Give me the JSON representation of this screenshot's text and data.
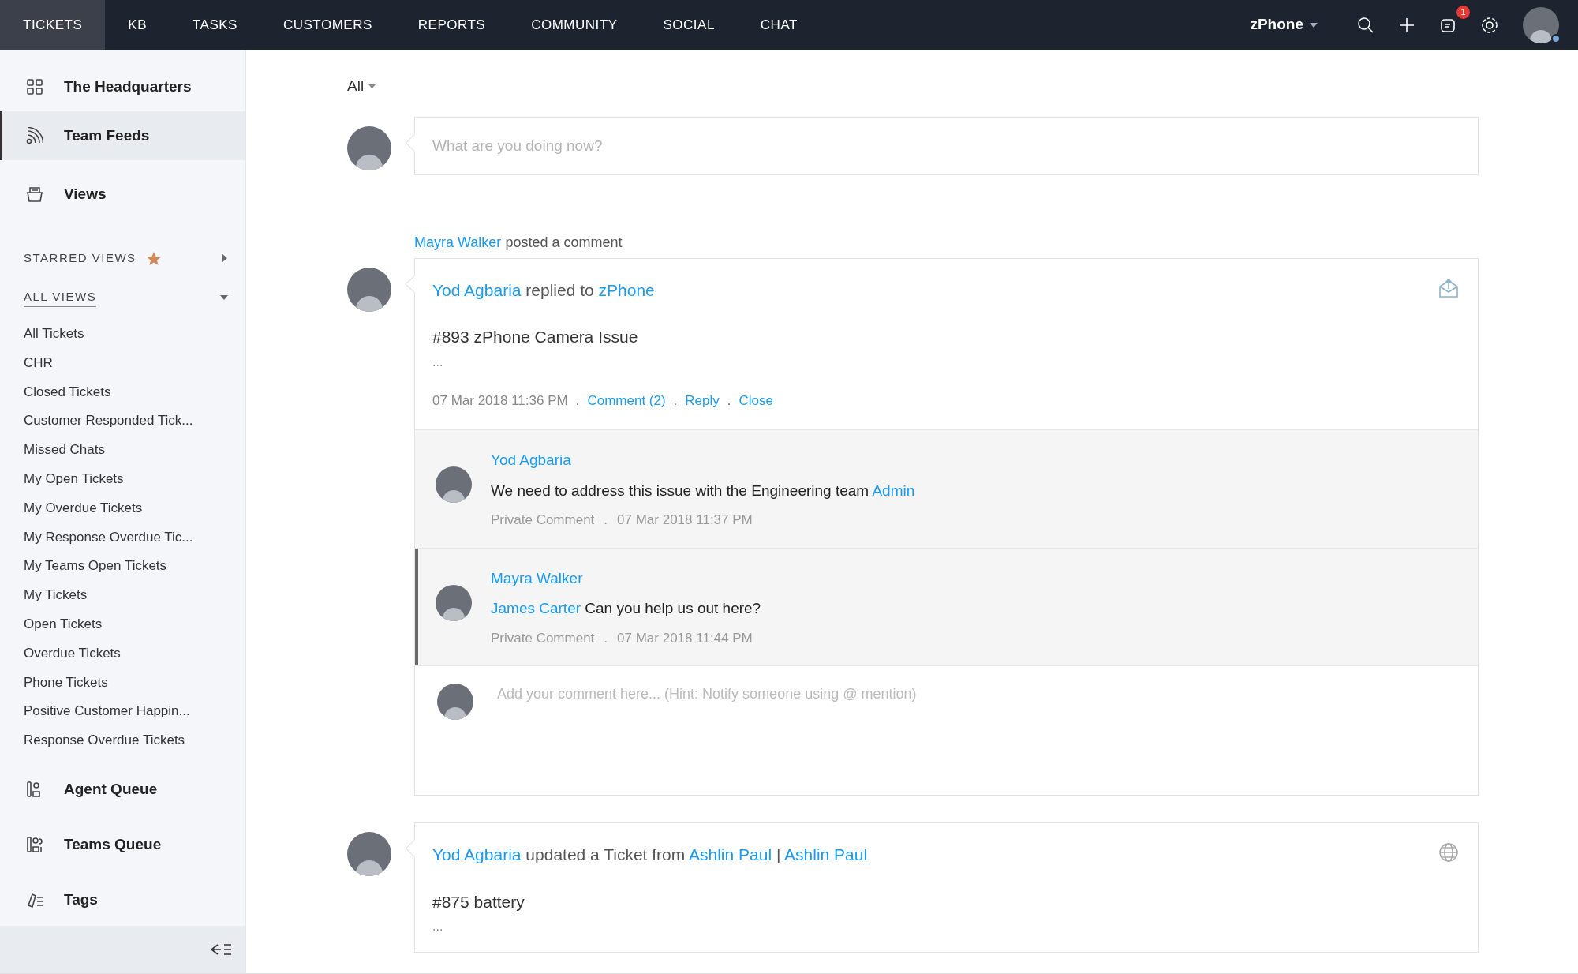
{
  "nav": {
    "tabs": [
      {
        "label": "TICKETS",
        "selected": true
      },
      {
        "label": "KB",
        "selected": false
      },
      {
        "label": "TASKS",
        "selected": false
      },
      {
        "label": "CUSTOMERS",
        "selected": false
      },
      {
        "label": "REPORTS",
        "selected": false
      },
      {
        "label": "COMMUNITY",
        "selected": false
      },
      {
        "label": "SOCIAL",
        "selected": false
      },
      {
        "label": "CHAT",
        "selected": false
      }
    ],
    "department": "zPhone",
    "notification_count": "1"
  },
  "sidebar": {
    "top_items": [
      {
        "label": "The Headquarters",
        "selected": false
      },
      {
        "label": "Team Feeds",
        "selected": true
      },
      {
        "label": "Views",
        "selected": false
      }
    ],
    "starred_views": {
      "label": "STARRED VIEWS",
      "expanded": false
    },
    "all_views": {
      "label": "ALL VIEWS",
      "expanded": true
    },
    "views": [
      "All Tickets",
      "CHR",
      "Closed Tickets",
      "Customer Responded Tick...",
      "Missed Chats",
      "My Open Tickets",
      "My Overdue Tickets",
      "My Response Overdue Tic...",
      "My Teams Open Tickets",
      "My Tickets",
      "Open Tickets",
      "Overdue Tickets",
      "Phone Tickets",
      "Positive Customer Happin...",
      "Response Overdue Tickets"
    ],
    "bottom_items": [
      {
        "label": "Agent Queue",
        "selected": false
      },
      {
        "label": "Teams Queue",
        "selected": false
      },
      {
        "label": "Tags",
        "selected": false
      }
    ]
  },
  "feed": {
    "filter": "All",
    "composer": {
      "placeholder": "What are you doing now?"
    },
    "posts": [
      {
        "activity": [
          {
            "kind": "link",
            "text": "Mayra Walker"
          },
          {
            "kind": "text",
            "text": "posted a comment"
          }
        ],
        "kind": "email",
        "header": [
          {
            "kind": "link",
            "text": "Yod Agbaria"
          },
          {
            "kind": "text",
            "text": "replied to"
          },
          {
            "kind": "link",
            "text": "zPhone"
          }
        ],
        "title": "#893 zPhone Camera Issue",
        "more": "...",
        "meta": [
          {
            "kind": "text",
            "text": "07 Mar 2018 11:36 PM"
          },
          {
            "kind": "sep",
            "text": "."
          },
          {
            "kind": "link",
            "text": "Comment (2)"
          },
          {
            "kind": "sep",
            "text": "."
          },
          {
            "kind": "link",
            "text": "Reply"
          },
          {
            "kind": "sep",
            "text": "."
          },
          {
            "kind": "link",
            "text": "Close"
          }
        ],
        "comments": [
          {
            "author": "Yod Agbaria",
            "highlighted": false,
            "body": [
              {
                "kind": "text",
                "text": "We need to address this issue with the Engineering team"
              },
              {
                "kind": "link",
                "text": "Admin"
              }
            ],
            "meta": [
              "Private Comment",
              ".",
              "07 Mar 2018 11:37 PM"
            ]
          },
          {
            "author": "Mayra Walker",
            "highlighted": true,
            "body": [
              {
                "kind": "link",
                "text": "James Carter"
              },
              {
                "kind": "text",
                "text": "Can you help us out here?"
              }
            ],
            "meta": [
              "Private Comment",
              ".",
              "07 Mar 2018 11:44 PM"
            ]
          }
        ],
        "comment_box": {
          "placeholder": "Add your comment here... (Hint: Notify someone using @ mention)"
        }
      },
      {
        "kind": "web",
        "header": [
          {
            "kind": "link",
            "text": "Yod Agbaria"
          },
          {
            "kind": "text",
            "text": "updated a Ticket from"
          },
          {
            "kind": "link",
            "text": "Ashlin Paul"
          },
          {
            "kind": "text",
            "text": "|"
          },
          {
            "kind": "link",
            "text": "Ashlin Paul"
          }
        ],
        "title": "#875 battery",
        "more": "..."
      }
    ]
  }
}
